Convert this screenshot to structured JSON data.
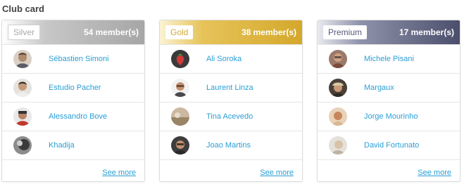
{
  "section_title": "Club card",
  "cards": [
    {
      "tier": "Silver",
      "member_count": "54 member(s)",
      "tier_color": "#a9a9a9",
      "badge_text_color": "#a9a9a9",
      "members": [
        {
          "name": "Sébastien Simoni",
          "avatar": "person-avatar"
        },
        {
          "name": "Estudio Pacher",
          "avatar": "person-avatar"
        },
        {
          "name": "Alessandro Bove",
          "avatar": "person-avatar"
        },
        {
          "name": "Khadija",
          "avatar": "person-avatar"
        }
      ],
      "see_more": "See more"
    },
    {
      "tier": "Gold",
      "member_count": "38 member(s)",
      "tier_color": "#d8b23a",
      "badge_text_color": "#d8b23a",
      "members": [
        {
          "name": "Ali Soroka",
          "avatar": "strawberry-avatar"
        },
        {
          "name": "Laurent Linza",
          "avatar": "person-avatar"
        },
        {
          "name": "Tina Acevedo",
          "avatar": "landscape-avatar"
        },
        {
          "name": "Joao Martins",
          "avatar": "person-avatar"
        }
      ],
      "see_more": "See more"
    },
    {
      "tier": "Premium",
      "member_count": "17 member(s)",
      "tier_color": "#555a78",
      "badge_text_color": "#555a78",
      "members": [
        {
          "name": "Michele Pisani",
          "avatar": "person-avatar"
        },
        {
          "name": "Margaux",
          "avatar": "person-avatar"
        },
        {
          "name": "Jorge Mourinho",
          "avatar": "person-avatar"
        },
        {
          "name": "David Fortunato",
          "avatar": "person-avatar"
        }
      ],
      "see_more": "See more"
    }
  ]
}
